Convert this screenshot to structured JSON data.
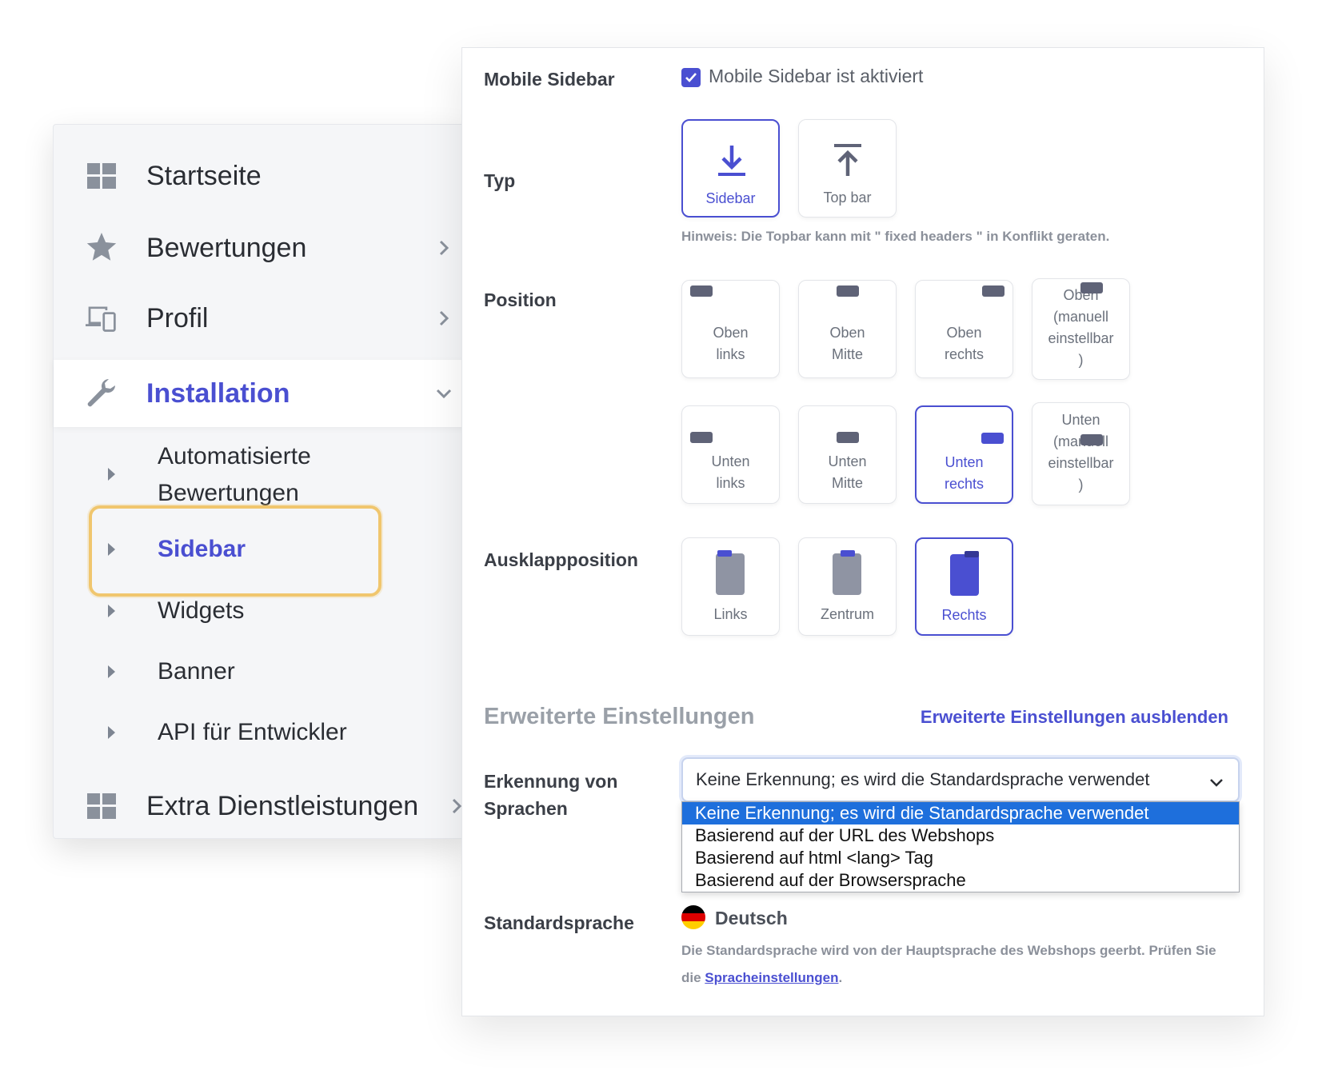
{
  "nav": {
    "items": [
      {
        "label": "Startseite",
        "icon": "grid-icon"
      },
      {
        "label": "Bewertungen",
        "icon": "star-icon"
      },
      {
        "label": "Profil",
        "icon": "devices-icon"
      },
      {
        "label": "Installation",
        "icon": "wrench-icon",
        "active": true
      },
      {
        "label": "Extra Dienstleistungen",
        "icon": "grid-icon"
      }
    ],
    "sub_items": [
      {
        "label": "Automatisierte Bewertungen"
      },
      {
        "label": "Sidebar",
        "current": true
      },
      {
        "label": "Widgets"
      },
      {
        "label": "Banner"
      },
      {
        "label": "API für Entwickler"
      }
    ]
  },
  "settings": {
    "mobile_sidebar": {
      "label": "Mobile Sidebar",
      "checkbox_label": "Mobile Sidebar ist aktiviert",
      "checked": true
    },
    "typ": {
      "label": "Typ",
      "options": [
        {
          "label": "Sidebar",
          "icon": "download-icon",
          "selected": true
        },
        {
          "label": "Top bar",
          "icon": "upload-icon",
          "selected": false
        }
      ],
      "hint": "Hinweis: Die Topbar kann mit \" fixed headers \" in Konflikt geraten."
    },
    "position": {
      "label": "Position",
      "options": [
        {
          "label": "Oben links",
          "selected": false
        },
        {
          "label": "Oben Mitte",
          "selected": false
        },
        {
          "label": "Oben rechts",
          "selected": false
        },
        {
          "label": "Oben (manuell einstellbar )",
          "selected": false
        },
        {
          "label": "Unten links",
          "selected": false
        },
        {
          "label": "Unten Mitte",
          "selected": false
        },
        {
          "label": "Unten rechts",
          "selected": true
        },
        {
          "label": "Unten (manuell einstellbar )",
          "selected": false
        }
      ]
    },
    "ausklapp": {
      "label": "Ausklappposition",
      "options": [
        {
          "label": "Links",
          "selected": false
        },
        {
          "label": "Zentrum",
          "selected": false
        },
        {
          "label": "Rechts",
          "selected": true
        }
      ]
    },
    "advanced": {
      "title": "Erweiterte Einstellungen",
      "toggle_link": "Erweiterte Einstellungen ausblenden"
    },
    "language_detection": {
      "label": "Erkennung von Sprachen",
      "selected": "Keine Erkennung; es wird die Standardsprache verwendet",
      "options": [
        "Keine Erkennung; es wird die Standardsprache verwendet",
        "Basierend auf der URL des Webshops",
        "Basierend auf html <lang> Tag",
        "Basierend auf der Browsersprache"
      ]
    },
    "default_language": {
      "label": "Standardsprache",
      "value": "Deutsch",
      "flag_colors": [
        "#000000",
        "#dd0000",
        "#ffce00"
      ],
      "note_before": "Die Standardsprache wird von der Hauptsprache des Webshops geerbt. Prüfen Sie die ",
      "note_link": "Spracheinstellungen",
      "note_after": "."
    }
  },
  "colors": {
    "accent": "#4a4fd1",
    "highlight": "#f0c66e",
    "dropdown_highlight": "#1e6fdc"
  }
}
